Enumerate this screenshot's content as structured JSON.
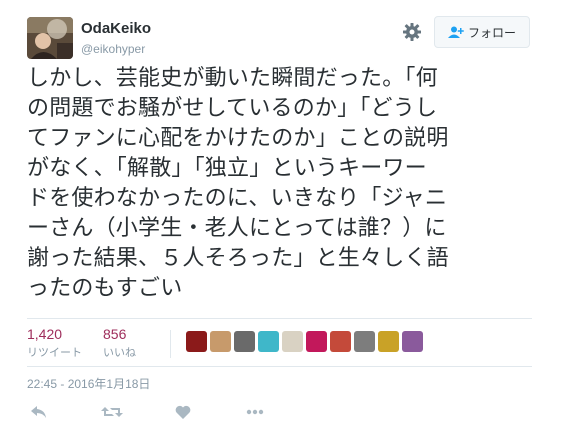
{
  "user": {
    "display_name": "OdaKeiko",
    "handle": "@eikohyper",
    "avatar_icon": "avatar-photo"
  },
  "header": {
    "settings_icon": "gear-icon",
    "follow_label": "フォロー",
    "follow_icon": "add-person-icon"
  },
  "tweet": {
    "text": "しかし、芸能史が動いた瞬間だった。「何\nの問題でお騒がせしているのか」「どうし\nてファンに心配をかけたのか」ことの説明\nがなく、「解散」「独立」というキーワー\nドを使わなかったのに、いきなり「ジャニ\nーさん（小学生・老人にとっては誰？）に\n謝った結果、５人そろった」と生々しく語\nったのもすごい"
  },
  "stats": {
    "retweets": {
      "count": "1,420",
      "label": "リツイート"
    },
    "likes": {
      "count": "856",
      "label": "いいね"
    },
    "liker_colors": [
      "#8b1a1a",
      "#c79a6b",
      "#6a6a6a",
      "#3fb7c9",
      "#d9d2c3",
      "#c2185b",
      "#c44a3a",
      "#7d7d7d",
      "#c9a227",
      "#8a5a9c"
    ]
  },
  "timestamp": "22:45 - 2016年1月18日",
  "actions": {
    "reply_icon": "reply-icon",
    "retweet_icon": "retweet-icon",
    "like_icon": "heart-icon",
    "more_icon": "more-icon"
  },
  "colors": {
    "count_accent": "#9e2d5b",
    "muted": "#8899a6",
    "icon_gray": "#aab8c2"
  }
}
